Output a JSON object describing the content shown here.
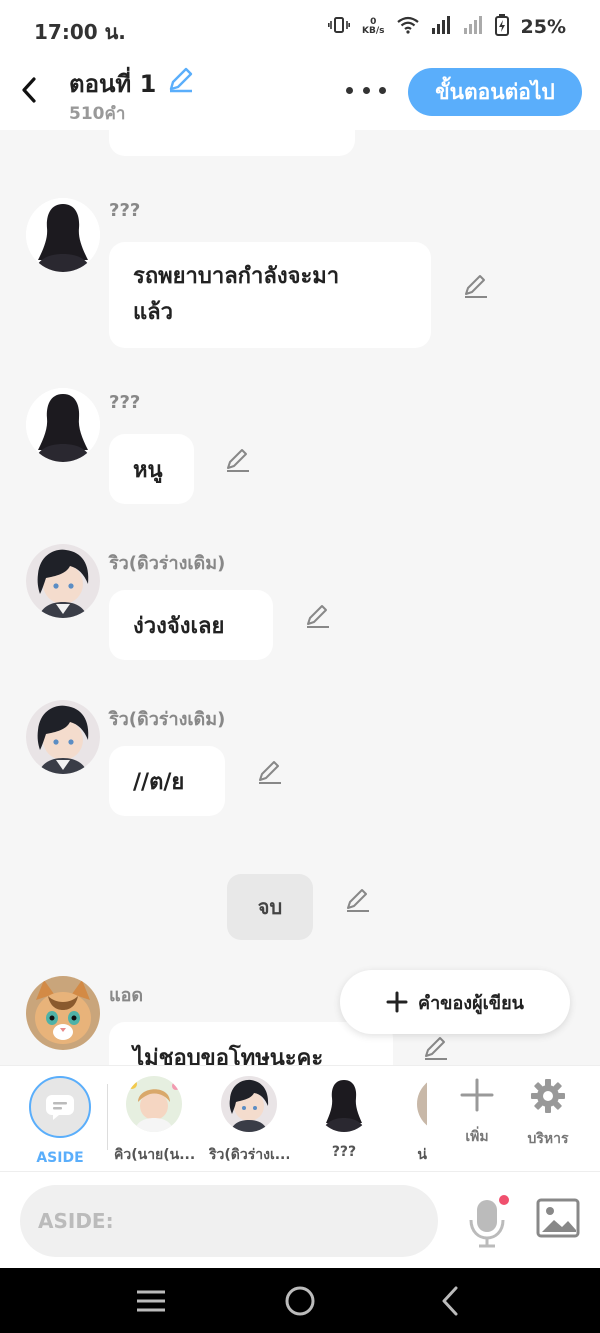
{
  "status": {
    "time": "17:00 น.",
    "net_rate_top": "0",
    "net_rate_unit": "KB/s",
    "battery": "25%"
  },
  "header": {
    "title": "ตอนที่ 1",
    "word_count": "510คำ",
    "next_button": "ขั้นตอนต่อไป"
  },
  "messages": [
    {
      "speaker": "???",
      "text_lines": [
        "รถพยาบาลกำลังจะมา",
        "แล้ว"
      ]
    },
    {
      "speaker": "???",
      "text": "หนู"
    },
    {
      "speaker": "ริว(ดิวร่างเดิม)",
      "text": "ง่วงจังเลย"
    },
    {
      "speaker": "ริว(ดิวร่างเดิม)",
      "text": "//ต/ย"
    },
    {
      "system": "จบ"
    },
    {
      "speaker": "แอด",
      "text": "ไม่ชอบขอโทษนะคะ"
    }
  ],
  "writer_button": "คำของผู้เขียน",
  "characters": [
    {
      "label": "ASIDE"
    },
    {
      "label": "คิว(นาย(น..."
    },
    {
      "label": "ริว(ดิวร่างเ..."
    },
    {
      "label": "???"
    },
    {
      "label": "น่"
    }
  ],
  "tools": {
    "add": "เพิ่ม",
    "manage": "บริหาร"
  },
  "input": {
    "placeholder": "ASIDE:"
  },
  "colors": {
    "accent": "#5aaefb",
    "record_dot": "#f0506e"
  }
}
